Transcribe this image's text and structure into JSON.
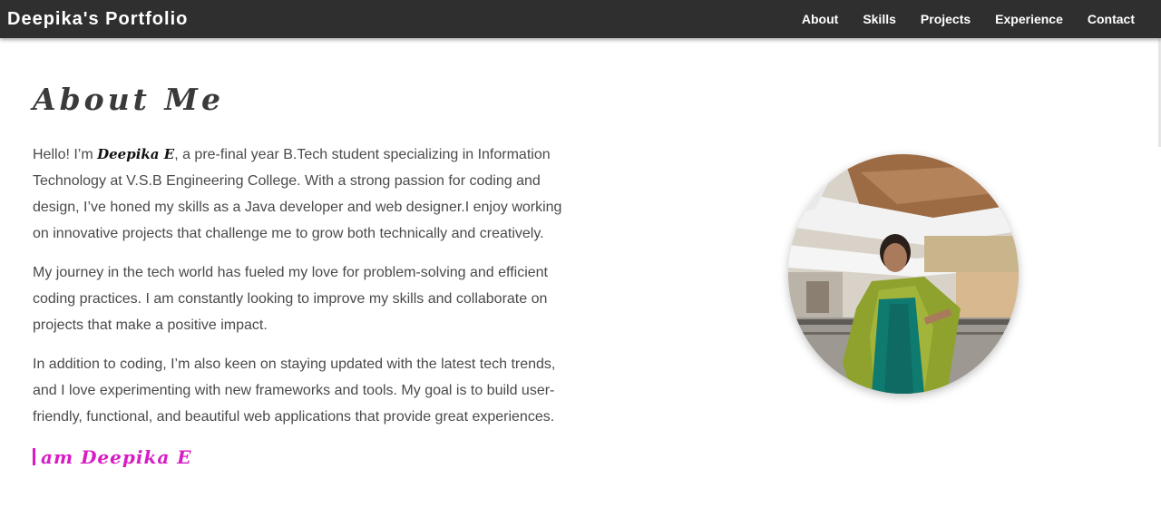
{
  "navbar": {
    "brand": "Deepika's Portfolio",
    "links": [
      "About",
      "Skills",
      "Projects",
      "Experience",
      "Contact"
    ]
  },
  "about": {
    "title": "About Me",
    "intro_before": "Hello! I’m ",
    "intro_name": "Deepika E",
    "intro_after": ", a pre-final year B.Tech student specializing in Information Technology at V.S.B Engineering College. With a strong passion for coding and design, I’ve honed my skills as a Java developer and web designer.I enjoy working on innovative projects that challenge me to grow both technically and creatively.",
    "paragraph2": "My journey in the tech world has fueled my love for problem-solving and efficient coding practices. I am constantly looking to improve my skills and collaborate on projects that make a positive impact.",
    "paragraph3": "In addition to coding, I’m also keen on staying updated with the latest tech trends, and I love experimenting with new frameworks and tools. My goal is to build user-friendly, functional, and beautiful web applications that provide great experiences.",
    "tagline": "am Deepika E"
  },
  "colors": {
    "navbar_bg": "#2f2f2f",
    "tagline": "#d81bc4",
    "text": "#4a4a4a"
  }
}
